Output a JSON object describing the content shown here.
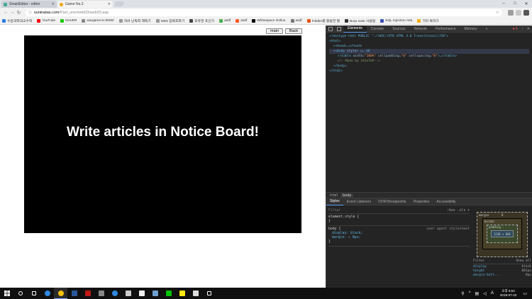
{
  "browser": {
    "tabs": [
      {
        "title": "SmartEditor - editor",
        "active": false
      },
      {
        "title": "Game No.3",
        "active": true
      }
    ],
    "url_host": "suninatas.com",
    "url_path": "/Part_one/web03/web03.asp",
    "window_controls": [
      "–",
      "□",
      "✕"
    ],
    "bookmarks": [
      {
        "label": "수원과학대교수학",
        "color": "#2a7de1"
      },
      {
        "label": "YouTube",
        "color": "#ff0000"
      },
      {
        "label": "NAVER",
        "color": "#1ec800"
      },
      {
        "label": "wargame.kr:8080/",
        "color": "#888888"
      },
      {
        "label": "자바 난독화 해독기",
        "color": "#999999"
      },
      {
        "label": "MD5 암복호화기",
        "color": "#999999"
      },
      {
        "label": "포유한 포인가",
        "color": "#444444"
      },
      {
        "label": "asdf",
        "color": "#4caf50"
      },
      {
        "label": "asdf",
        "color": "#ff5722"
      },
      {
        "label": "Whitespace Online",
        "color": "#000000"
      },
      {
        "label": "asdf",
        "color": "#777777"
      },
      {
        "label": "Fiddler를 활용한 웹",
        "color": "#e65100"
      },
      {
        "label": "Burp suite 사용법",
        "color": "#333333"
      },
      {
        "label": "SQL Injection Atta",
        "color": "#3f51b5"
      },
      {
        "label": "기타 북마크",
        "color": "#f0b400"
      }
    ]
  },
  "page": {
    "buttons": {
      "main": "main",
      "back": "Back"
    },
    "headline": "Write articles in Notice Board!",
    "background": "#000000"
  },
  "devtools": {
    "tabs": [
      "Elements",
      "Console",
      "Sources",
      "Network",
      "Performance",
      "Memory",
      "»"
    ],
    "active_tab": "Elements",
    "error_count": "5",
    "dom_lines": [
      {
        "indent": 0,
        "parts": [
          [
            "tag",
            "<!doctype html PUBLIC \"-//W3C//DTD HTML 4.0 Transitional//EN\">"
          ]
        ]
      },
      {
        "indent": 0,
        "parts": [
          [
            "tag",
            "<html>"
          ]
        ]
      },
      {
        "indent": 1,
        "parts": [
          [
            "tag",
            "▸<head>…</head>"
          ]
        ]
      },
      {
        "indent": 1,
        "parts": [
          [
            "tag",
            "▾<body "
          ],
          [
            "attr",
            "style"
          ],
          [
            "tag",
            "> == $0"
          ]
        ],
        "selected": true
      },
      {
        "indent": 2,
        "parts": [
          [
            "tag",
            "▸<table "
          ],
          [
            "attr",
            "width="
          ],
          [
            "val",
            "\"100%\" "
          ],
          [
            "attr",
            "cellpadding="
          ],
          [
            "val",
            "\"0\" "
          ],
          [
            "attr",
            "cellspacing="
          ],
          [
            "val",
            "\"0\""
          ],
          [
            "tag",
            ">…</table>"
          ]
        ]
      },
      {
        "indent": 2,
        "parts": [
          [
            "cmt",
            "<!--Made by 2theTmP-->"
          ]
        ]
      },
      {
        "indent": 1,
        "parts": [
          [
            "tag",
            "</body>"
          ]
        ]
      },
      {
        "indent": 0,
        "parts": [
          [
            "tag",
            "</html>"
          ]
        ]
      }
    ],
    "breadcrumbs": [
      "html",
      "body"
    ],
    "subtabs": [
      "Styles",
      "Event Listeners",
      "DOM Breakpoints",
      "Properties",
      "Accessibility"
    ],
    "filter_placeholder": "Filter",
    "filter_right": ":hov  .cls  +",
    "rules": [
      {
        "selector": "element.style {",
        "source": "",
        "props": [],
        "close": "}"
      },
      {
        "selector": "body {",
        "source": "user agent stylesheet",
        "props": [
          "display: block;",
          "margin: ▸ 8px;"
        ],
        "close": "}"
      }
    ],
    "boxmodel": {
      "margin_label": "margin",
      "margin_val": "8",
      "border_label": "border",
      "border_val": "-",
      "padding_label": "padding -",
      "content": "1139 × 601"
    },
    "computed_filter": "Filter",
    "computed_showall": "Show all",
    "computed": [
      {
        "k": "display",
        "v": "block"
      },
      {
        "k": "height",
        "v": "601px"
      },
      {
        "k": "margin-bott...",
        "v": "8px"
      }
    ]
  },
  "taskbar": {
    "icons": [
      {
        "name": "start",
        "color": "#ffffff"
      },
      {
        "name": "search",
        "color": "#ffffff"
      },
      {
        "name": "task-view",
        "color": "#ffffff"
      },
      {
        "name": "edge",
        "color": "#2e89e0"
      },
      {
        "name": "chrome",
        "color": "#f4c20d",
        "active": true
      },
      {
        "name": "word",
        "color": "#2b579a"
      },
      {
        "name": "mcafee",
        "color": "#c01818"
      },
      {
        "name": "app",
        "color": "#888888"
      },
      {
        "name": "edge2",
        "color": "#2e89e0"
      },
      {
        "name": "mail",
        "color": "#cccccc"
      },
      {
        "name": "store",
        "color": "#f0f0f0"
      },
      {
        "name": "steam",
        "color": "#6fa0d0"
      },
      {
        "name": "line",
        "color": "#00c300"
      },
      {
        "name": "kakao",
        "color": "#ffe812"
      },
      {
        "name": "app2",
        "color": "#dddddd"
      },
      {
        "name": "settings",
        "color": "#ffffff"
      }
    ],
    "time": "오후 6:52",
    "date": "2018-07-22"
  }
}
